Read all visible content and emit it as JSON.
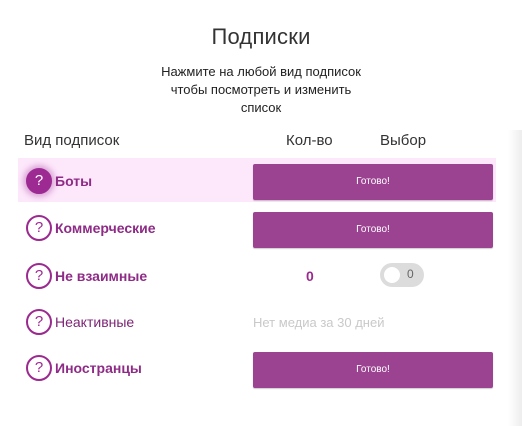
{
  "header": {
    "title": "Подписки",
    "subtitle_lines": [
      "Нажмите на любой вид подписок",
      "чтобы посмотреть и изменить",
      "список"
    ]
  },
  "columns": {
    "type": "Вид подписок",
    "count": "Кол-во",
    "choice": "Выбор"
  },
  "rows": [
    {
      "label": "Боты",
      "action": "Готово!"
    },
    {
      "label": "Коммерческие",
      "action": "Готово!"
    },
    {
      "label": "Не взаимные",
      "count": "0",
      "toggle_value": "0"
    },
    {
      "label": "Неактивные",
      "note": "Нет медиа за 30 дней"
    },
    {
      "label": "Иностранцы",
      "action": "Готово!"
    }
  ],
  "icons": {
    "help": "question-circle-icon"
  },
  "colors": {
    "accent": "#9b4391",
    "highlight_row": "#fde7fb",
    "label": "#8e2b86"
  }
}
